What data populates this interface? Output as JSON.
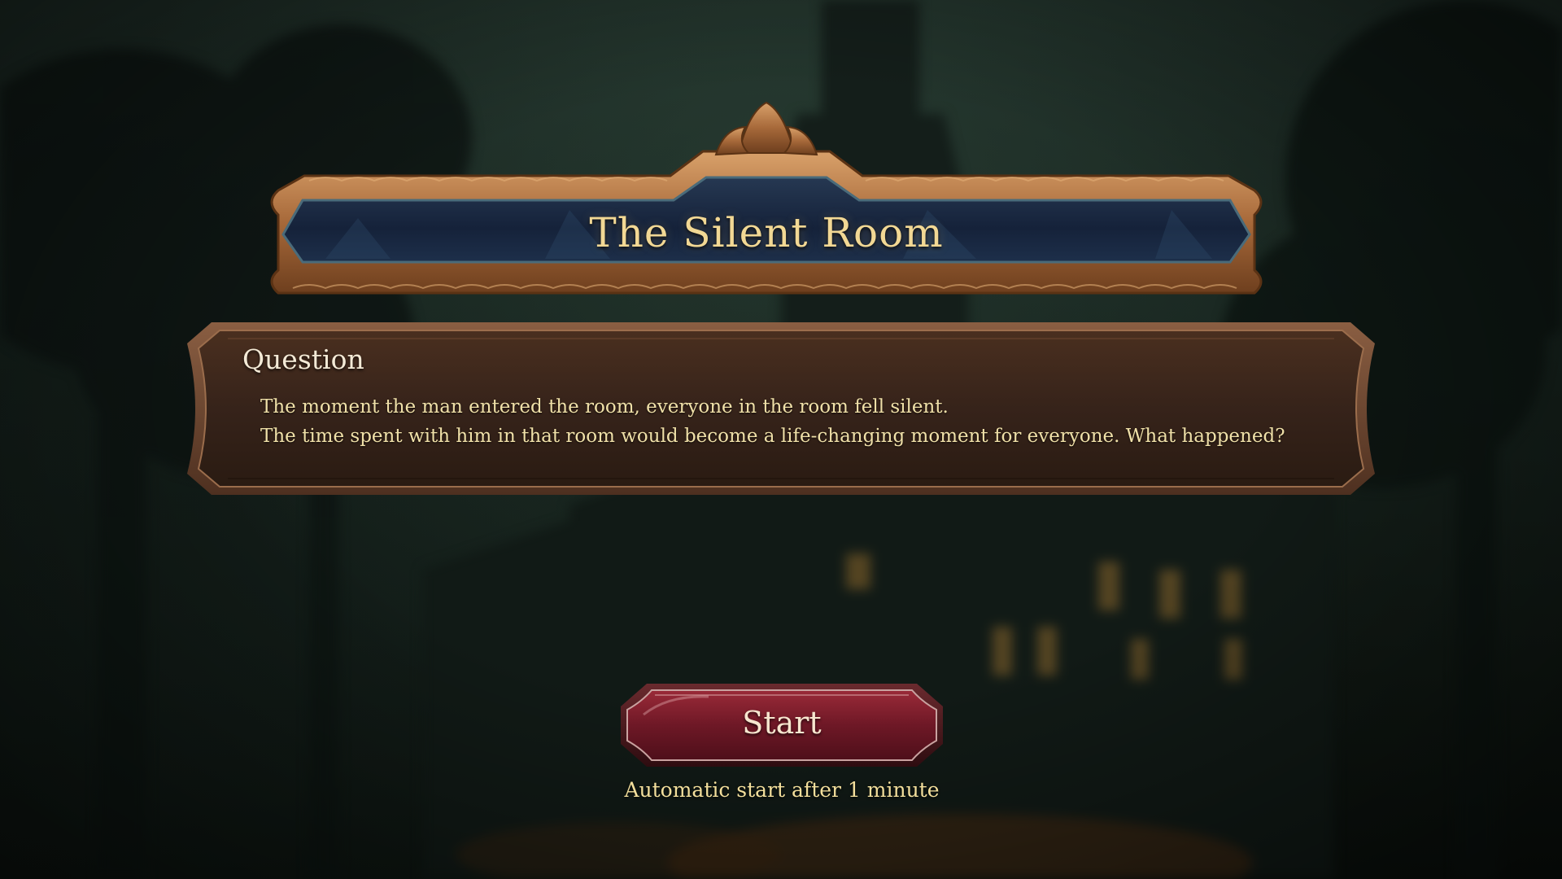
{
  "game": {
    "title": "The Silent Room",
    "question": {
      "heading": "Question",
      "lines": [
        "The moment the man entered the room, everyone in the room fell silent.",
        "The time spent with him in that room would become a life-changing moment for everyone. What happened?"
      ]
    },
    "start_button": {
      "label": "Start"
    },
    "auto_start_text": "Automatic start after 1 minute"
  },
  "colors": {
    "title_text": "#f2d894",
    "frame_gold": "#b37a45",
    "title_panel": "#1c2a45",
    "question_panel": "#3b2619",
    "start_button": "#7a1e2a",
    "auto_start_text": "#f3df9c"
  },
  "background": {
    "scene": "haunted-mansion-night",
    "icons": [
      "mansion-silhouette",
      "tree-silhouette",
      "lit-windows"
    ]
  }
}
